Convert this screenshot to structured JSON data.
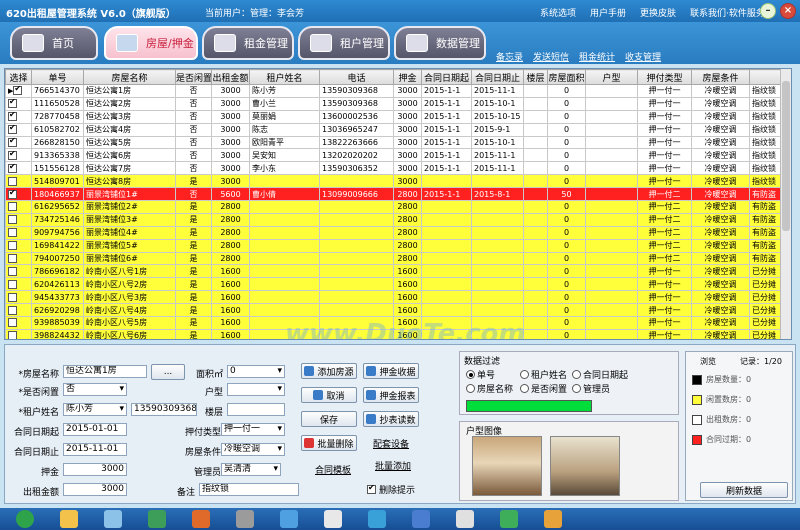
{
  "window": {
    "title": "620出租屋管理系统 V6.0（旗舰版）",
    "current_user": "当前用户：管理：李会芳"
  },
  "top_links": [
    "系统选项",
    "用户手册",
    "更换皮肤",
    "联系我们·软件服务"
  ],
  "tabs": [
    {
      "label": "首页",
      "active": false
    },
    {
      "label": "房屋/押金",
      "active": true
    },
    {
      "label": "租金管理",
      "active": false
    },
    {
      "label": "租户管理",
      "active": false
    },
    {
      "label": "数据管理",
      "active": false
    }
  ],
  "sub_links": [
    "备忘录",
    "发送短信",
    "租金统计",
    "收支管理"
  ],
  "table": {
    "headers": [
      "选择",
      "单号",
      "房屋名称",
      "是否闲置",
      "出租金额",
      "租户姓名",
      "电话",
      "押金",
      "合同日期起",
      "合同日期止",
      "楼层",
      "房屋面积",
      "户型",
      "押付类型",
      "房屋条件",
      ""
    ],
    "rows": [
      {
        "style": "white",
        "mark": "▶",
        "chk": true,
        "cells": [
          "766514370",
          "恒达公寓1房",
          "否",
          "3000",
          "陈小芳",
          "13590309368",
          "3000",
          "2015-1-1",
          "2015-11-1",
          "",
          "0",
          "",
          "押一付一",
          "冷暖空调",
          "指纹锁"
        ]
      },
      {
        "style": "white",
        "mark": "",
        "chk": true,
        "cells": [
          "111650528",
          "恒达公寓2房",
          "否",
          "3000",
          "曹小兰",
          "13590309368",
          "3000",
          "2015-1-1",
          "2015-10-1",
          "",
          "0",
          "",
          "押一付一",
          "冷暖空调",
          "指纹锁"
        ]
      },
      {
        "style": "white",
        "mark": "",
        "chk": true,
        "cells": [
          "728770458",
          "恒达公寓3房",
          "否",
          "3000",
          "莫丽娟",
          "13600002536",
          "3000",
          "2015-1-1",
          "2015-10-15",
          "",
          "0",
          "",
          "押一付一",
          "冷暖空调",
          "指纹锁"
        ]
      },
      {
        "style": "white",
        "mark": "",
        "chk": true,
        "cells": [
          "610582702",
          "恒达公寓4房",
          "否",
          "3000",
          "陈志",
          "13036965247",
          "3000",
          "2015-1-1",
          "2015-9-1",
          "",
          "0",
          "",
          "押一付一",
          "冷暖空调",
          "指纹锁"
        ]
      },
      {
        "style": "white",
        "mark": "",
        "chk": true,
        "cells": [
          "266828150",
          "恒达公寓5房",
          "否",
          "3000",
          "欧阳青平",
          "13822263666",
          "3000",
          "2015-1-1",
          "2015-10-1",
          "",
          "0",
          "",
          "押一付一",
          "冷暖空调",
          "指纹锁"
        ]
      },
      {
        "style": "white",
        "mark": "",
        "chk": true,
        "cells": [
          "913365338",
          "恒达公寓6房",
          "否",
          "3000",
          "吴安知",
          "13202020202",
          "3000",
          "2015-1-1",
          "2015-11-1",
          "",
          "0",
          "",
          "押一付一",
          "冷暖空调",
          "指纹锁"
        ]
      },
      {
        "style": "white",
        "mark": "",
        "chk": true,
        "cells": [
          "151556128",
          "恒达公寓7房",
          "否",
          "3000",
          "李小东",
          "13590306352",
          "3000",
          "2015-1-1",
          "2015-11-1",
          "",
          "0",
          "",
          "押一付一",
          "冷暖空调",
          "指纹锁"
        ]
      },
      {
        "style": "yellow",
        "mark": "",
        "chk": false,
        "cells": [
          "514809701",
          "恒达公寓8房",
          "是",
          "3000",
          "",
          "",
          "3000",
          "",
          "",
          "",
          "0",
          "",
          "押一付一",
          "冷暖空调",
          "指纹锁"
        ]
      },
      {
        "style": "red",
        "mark": "",
        "chk": true,
        "cells": [
          "180466937",
          "丽景湾铺位1#",
          "否",
          "5600",
          "曹小倩",
          "13099009666",
          "2800",
          "2015-1-1",
          "2015-8-1",
          "",
          "50",
          "",
          "押一付二",
          "冷暖空调",
          "有防盗"
        ]
      },
      {
        "style": "yellow",
        "mark": "",
        "chk": false,
        "cells": [
          "616295652",
          "丽景湾铺位2#",
          "是",
          "2800",
          "",
          "",
          "2800",
          "",
          "",
          "",
          "0",
          "",
          "押一付二",
          "冷暖空调",
          "有防盗"
        ]
      },
      {
        "style": "yellow",
        "mark": "",
        "chk": false,
        "cells": [
          "734725146",
          "丽景湾铺位3#",
          "是",
          "2800",
          "",
          "",
          "2800",
          "",
          "",
          "",
          "0",
          "",
          "押一付二",
          "冷暖空调",
          "有防盗"
        ]
      },
      {
        "style": "yellow",
        "mark": "",
        "chk": false,
        "cells": [
          "909794756",
          "丽景湾铺位4#",
          "是",
          "2800",
          "",
          "",
          "2800",
          "",
          "",
          "",
          "0",
          "",
          "押一付二",
          "冷暖空调",
          "有防盗"
        ]
      },
      {
        "style": "yellow",
        "mark": "",
        "chk": false,
        "cells": [
          "169841422",
          "丽景湾铺位5#",
          "是",
          "2800",
          "",
          "",
          "2800",
          "",
          "",
          "",
          "0",
          "",
          "押一付二",
          "冷暖空调",
          "有防盗"
        ]
      },
      {
        "style": "yellow",
        "mark": "",
        "chk": false,
        "cells": [
          "794007250",
          "丽景湾铺位6#",
          "是",
          "2800",
          "",
          "",
          "2800",
          "",
          "",
          "",
          "0",
          "",
          "押一付二",
          "冷暖空调",
          "有防盗"
        ]
      },
      {
        "style": "yellow",
        "mark": "",
        "chk": false,
        "cells": [
          "786696182",
          "岭南小区八号1房",
          "是",
          "1600",
          "",
          "",
          "1600",
          "",
          "",
          "",
          "0",
          "",
          "押一付一",
          "冷暖空调",
          "已分摊"
        ]
      },
      {
        "style": "yellow",
        "mark": "",
        "chk": false,
        "cells": [
          "620426113",
          "岭南小区八号2房",
          "是",
          "1600",
          "",
          "",
          "1600",
          "",
          "",
          "",
          "0",
          "",
          "押一付一",
          "冷暖空调",
          "已分摊"
        ]
      },
      {
        "style": "yellow",
        "mark": "",
        "chk": false,
        "cells": [
          "945433773",
          "岭南小区八号3房",
          "是",
          "1600",
          "",
          "",
          "1600",
          "",
          "",
          "",
          "0",
          "",
          "押一付一",
          "冷暖空调",
          "已分摊"
        ]
      },
      {
        "style": "yellow",
        "mark": "",
        "chk": false,
        "cells": [
          "626920298",
          "岭南小区八号4房",
          "是",
          "1600",
          "",
          "",
          "1600",
          "",
          "",
          "",
          "0",
          "",
          "押一付一",
          "冷暖空调",
          "已分摊"
        ]
      },
      {
        "style": "yellow",
        "mark": "",
        "chk": false,
        "cells": [
          "939885039",
          "岭南小区八号5房",
          "是",
          "1600",
          "",
          "",
          "1600",
          "",
          "",
          "",
          "0",
          "",
          "押一付一",
          "冷暖空调",
          "已分摊"
        ]
      },
      {
        "style": "yellow",
        "mark": "",
        "chk": false,
        "cells": [
          "398824432",
          "岭南小区八号6房",
          "是",
          "1600",
          "",
          "",
          "1600",
          "",
          "",
          "",
          "0",
          "",
          "押一付一",
          "冷暖空调",
          "已分摊"
        ]
      }
    ]
  },
  "watermark": "www.DuoTe.com",
  "form": {
    "house_name_label": "*房屋名称",
    "house_name_value": "恒达公寓1房",
    "more_button": "...",
    "area_label": "面积㎡",
    "area_value": "0",
    "vacant_label": "*是否闲置",
    "vacant_value": "否",
    "layout_label": "户型",
    "layout_value": "",
    "tenant_label": "*租户姓名",
    "tenant_value": "陈小芳",
    "phone_value": "13590309368",
    "floor_label": "楼层",
    "floor_value": "",
    "start_label": "合同日期起",
    "start_value": "2015-01-01",
    "pay_type_label": "押付类型",
    "pay_type_value": "押一付一",
    "end_label": "合同日期止",
    "end_value": "2015-11-01",
    "condition_label": "房屋条件",
    "condition_value": "冷暖空调",
    "deposit_label": "押金",
    "deposit_value": "3000",
    "admin_label": "管理员",
    "admin_value": "吴清清",
    "rent_label": "出租金额",
    "rent_value": "3000",
    "note_label": "备注",
    "note_value": "指纹锁"
  },
  "buttons": {
    "add_house": "添加房源",
    "cancel": "取消",
    "save": "保存",
    "batch_delete": "批量删除",
    "deposit_receive": "押金收据",
    "deposit_report": "押金报表",
    "meter_reading": "抄表读数",
    "config": "配套设备",
    "contract_template": "合同模板",
    "batch_add": "批量添加",
    "delete_prompt": "删除提示"
  },
  "filter": {
    "title": "数据过滤",
    "options": [
      {
        "label": "单号",
        "on": true
      },
      {
        "label": "租户姓名",
        "on": false
      },
      {
        "label": "合同日期起",
        "on": false
      },
      {
        "label": "房屋名称",
        "on": false
      },
      {
        "label": "是否闲置",
        "on": false
      },
      {
        "label": "管理员",
        "on": false
      }
    ]
  },
  "image_box": {
    "title": "户型图像"
  },
  "stats": {
    "browse_label": "浏览",
    "record_label": "记录：1/20",
    "items": [
      {
        "label": "房屋数量：0",
        "color": "#000000"
      },
      {
        "label": "闲置数房：0",
        "color": "#ffff3a"
      },
      {
        "label": "出租数房：0",
        "color": "#ffffff"
      },
      {
        "label": "合同过期：0",
        "color": "#ff2020"
      }
    ],
    "refresh_button": "刷新数据"
  },
  "colors": {
    "accent": "#2a7cc0",
    "vacant": "#ffff3a",
    "expired": "#ff2020",
    "filter_bar": "#00dc3a"
  }
}
